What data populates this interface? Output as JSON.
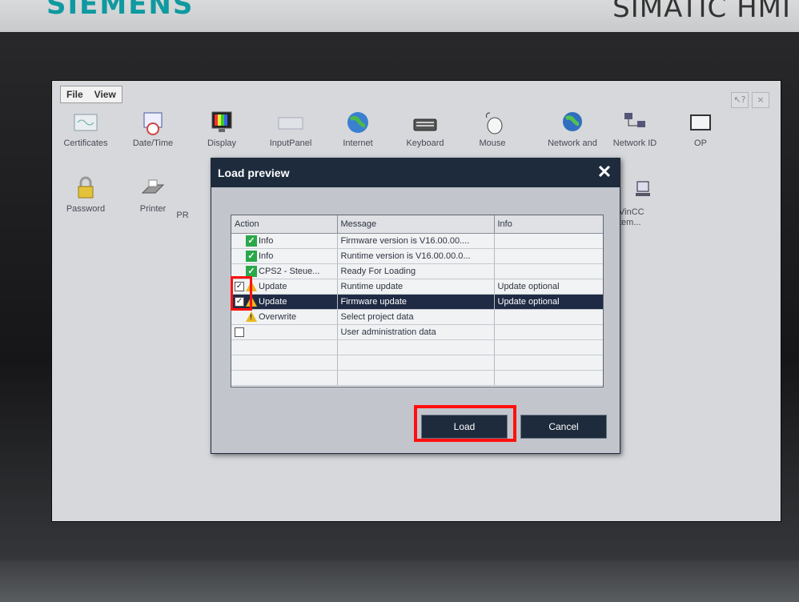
{
  "device": {
    "brand": "SIEMENS",
    "model": "SIMATIC HMI"
  },
  "menubar": {
    "file": "File",
    "view": "View"
  },
  "topbar": {
    "help": "↖?",
    "close": "×"
  },
  "icons": [
    {
      "label": "Certificates",
      "icon": "certificate-icon"
    },
    {
      "label": "Date/Time",
      "icon": "calendar-clock-icon"
    },
    {
      "label": "Display",
      "icon": "display-icon"
    },
    {
      "label": "InputPanel",
      "icon": "keyboard-panel-icon"
    },
    {
      "label": "Internet",
      "icon": "globe-icon"
    },
    {
      "label": "Keyboard",
      "icon": "keyboard-icon"
    },
    {
      "label": "Mouse",
      "icon": "mouse-icon"
    },
    {
      "label": "Network and",
      "icon": "network-globe-icon"
    },
    {
      "label": "Network ID",
      "icon": "network-id-icon"
    },
    {
      "label": "OP",
      "icon": "monitor-icon"
    },
    {
      "label": "Password",
      "icon": "lock-icon"
    },
    {
      "label": "Printer",
      "icon": "printer-icon"
    },
    {
      "label": "PR",
      "icon": "partial-icon"
    },
    {
      "label": "VinCC",
      "icon": "computer-icon"
    },
    {
      "label": "tem...",
      "icon": ""
    }
  ],
  "dialog": {
    "title": "Load preview",
    "columns": [
      "Action",
      "Message",
      "Info"
    ],
    "rows": [
      {
        "checkbox": "none",
        "status": "ok",
        "action": "Info",
        "message": "Firmware version is V16.00.00....",
        "info": ""
      },
      {
        "checkbox": "none",
        "status": "ok",
        "action": "Info",
        "message": "Runtime version is V16.00.00.0...",
        "info": ""
      },
      {
        "checkbox": "none",
        "status": "ok",
        "action": "CPS2 - Steue...",
        "message": "Ready For Loading",
        "info": ""
      },
      {
        "checkbox": "checked",
        "status": "warn",
        "action": "Update",
        "message": "Runtime update",
        "info": "Update optional"
      },
      {
        "checkbox": "checked",
        "status": "warn",
        "action": "Update",
        "message": "Firmware update",
        "info": "Update optional",
        "selected": true
      },
      {
        "checkbox": "none",
        "status": "warn",
        "action": "Overwrite",
        "message": "Select project data",
        "info": ""
      },
      {
        "checkbox": "unchecked",
        "status": "none",
        "action": "",
        "message": "User administration data",
        "info": ""
      }
    ],
    "load_label": "Load",
    "cancel_label": "Cancel"
  },
  "colors": {
    "accent": "#1e2b3d",
    "highlight": "#ff1010",
    "ok": "#2aa84a",
    "warn": "#e8b820"
  }
}
